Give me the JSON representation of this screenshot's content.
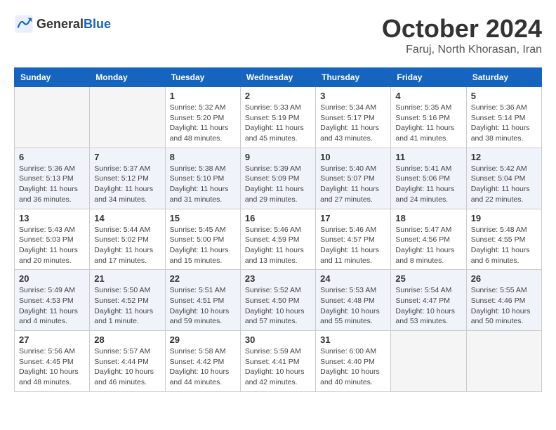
{
  "header": {
    "logo_general": "General",
    "logo_blue": "Blue",
    "month_title": "October 2024",
    "location": "Faruj, North Khorasan, Iran"
  },
  "weekdays": [
    "Sunday",
    "Monday",
    "Tuesday",
    "Wednesday",
    "Thursday",
    "Friday",
    "Saturday"
  ],
  "weeks": [
    [
      {
        "day": "",
        "info": ""
      },
      {
        "day": "",
        "info": ""
      },
      {
        "day": "1",
        "info": "Sunrise: 5:32 AM\nSunset: 5:20 PM\nDaylight: 11 hours and 48 minutes."
      },
      {
        "day": "2",
        "info": "Sunrise: 5:33 AM\nSunset: 5:19 PM\nDaylight: 11 hours and 45 minutes."
      },
      {
        "day": "3",
        "info": "Sunrise: 5:34 AM\nSunset: 5:17 PM\nDaylight: 11 hours and 43 minutes."
      },
      {
        "day": "4",
        "info": "Sunrise: 5:35 AM\nSunset: 5:16 PM\nDaylight: 11 hours and 41 minutes."
      },
      {
        "day": "5",
        "info": "Sunrise: 5:36 AM\nSunset: 5:14 PM\nDaylight: 11 hours and 38 minutes."
      }
    ],
    [
      {
        "day": "6",
        "info": "Sunrise: 5:36 AM\nSunset: 5:13 PM\nDaylight: 11 hours and 36 minutes."
      },
      {
        "day": "7",
        "info": "Sunrise: 5:37 AM\nSunset: 5:12 PM\nDaylight: 11 hours and 34 minutes."
      },
      {
        "day": "8",
        "info": "Sunrise: 5:38 AM\nSunset: 5:10 PM\nDaylight: 11 hours and 31 minutes."
      },
      {
        "day": "9",
        "info": "Sunrise: 5:39 AM\nSunset: 5:09 PM\nDaylight: 11 hours and 29 minutes."
      },
      {
        "day": "10",
        "info": "Sunrise: 5:40 AM\nSunset: 5:07 PM\nDaylight: 11 hours and 27 minutes."
      },
      {
        "day": "11",
        "info": "Sunrise: 5:41 AM\nSunset: 5:06 PM\nDaylight: 11 hours and 24 minutes."
      },
      {
        "day": "12",
        "info": "Sunrise: 5:42 AM\nSunset: 5:04 PM\nDaylight: 11 hours and 22 minutes."
      }
    ],
    [
      {
        "day": "13",
        "info": "Sunrise: 5:43 AM\nSunset: 5:03 PM\nDaylight: 11 hours and 20 minutes."
      },
      {
        "day": "14",
        "info": "Sunrise: 5:44 AM\nSunset: 5:02 PM\nDaylight: 11 hours and 17 minutes."
      },
      {
        "day": "15",
        "info": "Sunrise: 5:45 AM\nSunset: 5:00 PM\nDaylight: 11 hours and 15 minutes."
      },
      {
        "day": "16",
        "info": "Sunrise: 5:46 AM\nSunset: 4:59 PM\nDaylight: 11 hours and 13 minutes."
      },
      {
        "day": "17",
        "info": "Sunrise: 5:46 AM\nSunset: 4:57 PM\nDaylight: 11 hours and 11 minutes."
      },
      {
        "day": "18",
        "info": "Sunrise: 5:47 AM\nSunset: 4:56 PM\nDaylight: 11 hours and 8 minutes."
      },
      {
        "day": "19",
        "info": "Sunrise: 5:48 AM\nSunset: 4:55 PM\nDaylight: 11 hours and 6 minutes."
      }
    ],
    [
      {
        "day": "20",
        "info": "Sunrise: 5:49 AM\nSunset: 4:53 PM\nDaylight: 11 hours and 4 minutes."
      },
      {
        "day": "21",
        "info": "Sunrise: 5:50 AM\nSunset: 4:52 PM\nDaylight: 11 hours and 1 minute."
      },
      {
        "day": "22",
        "info": "Sunrise: 5:51 AM\nSunset: 4:51 PM\nDaylight: 10 hours and 59 minutes."
      },
      {
        "day": "23",
        "info": "Sunrise: 5:52 AM\nSunset: 4:50 PM\nDaylight: 10 hours and 57 minutes."
      },
      {
        "day": "24",
        "info": "Sunrise: 5:53 AM\nSunset: 4:48 PM\nDaylight: 10 hours and 55 minutes."
      },
      {
        "day": "25",
        "info": "Sunrise: 5:54 AM\nSunset: 4:47 PM\nDaylight: 10 hours and 53 minutes."
      },
      {
        "day": "26",
        "info": "Sunrise: 5:55 AM\nSunset: 4:46 PM\nDaylight: 10 hours and 50 minutes."
      }
    ],
    [
      {
        "day": "27",
        "info": "Sunrise: 5:56 AM\nSunset: 4:45 PM\nDaylight: 10 hours and 48 minutes."
      },
      {
        "day": "28",
        "info": "Sunrise: 5:57 AM\nSunset: 4:44 PM\nDaylight: 10 hours and 46 minutes."
      },
      {
        "day": "29",
        "info": "Sunrise: 5:58 AM\nSunset: 4:42 PM\nDaylight: 10 hours and 44 minutes."
      },
      {
        "day": "30",
        "info": "Sunrise: 5:59 AM\nSunset: 4:41 PM\nDaylight: 10 hours and 42 minutes."
      },
      {
        "day": "31",
        "info": "Sunrise: 6:00 AM\nSunset: 4:40 PM\nDaylight: 10 hours and 40 minutes."
      },
      {
        "day": "",
        "info": ""
      },
      {
        "day": "",
        "info": ""
      }
    ]
  ]
}
